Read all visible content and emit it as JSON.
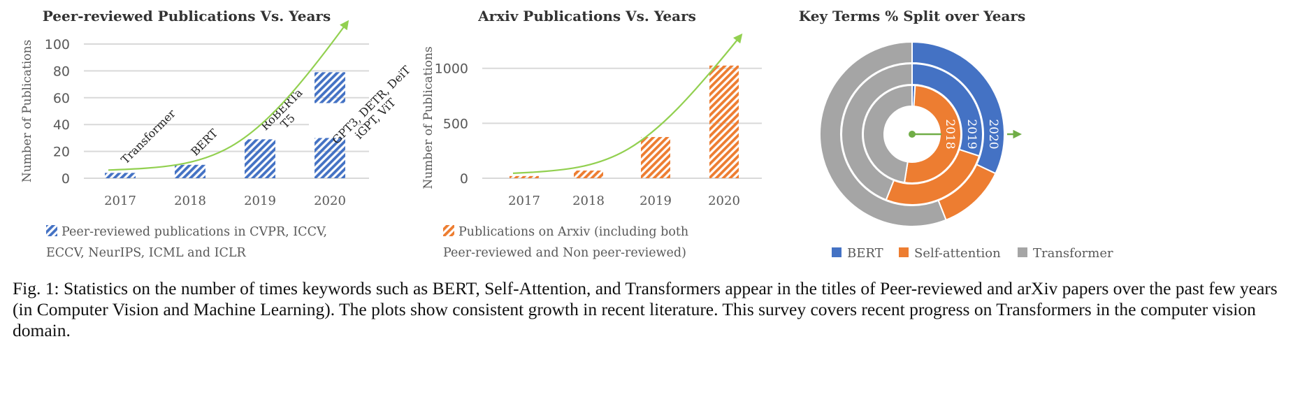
{
  "chart_data": [
    {
      "type": "bar",
      "title": "Peer-reviewed Publications Vs. Years",
      "ylabel": "Number of Publications",
      "xlabel": "",
      "categories": [
        "2017",
        "2018",
        "2019",
        "2020"
      ],
      "values": [
        4,
        10,
        29,
        79
      ],
      "ylim": [
        0,
        100
      ],
      "yticks": [
        0,
        20,
        40,
        60,
        80,
        100
      ],
      "grid": true,
      "bar_color": "#4472c4",
      "bar_fill": "diagonal-hatch",
      "annotations": [
        "Transformer",
        "BERT",
        "RoBERTa\nT5",
        "GPT3, DETR, DeiT\niGPT, ViT"
      ],
      "trend_arrow_color": "#92d050",
      "legend": {
        "position": "bottom",
        "entries": [
          "Peer-reviewed publications in CVPR, ICCV, ECCV, NeurIPS, ICML and ICLR"
        ]
      }
    },
    {
      "type": "bar",
      "title": "Arxiv Publications Vs. Years",
      "ylabel": "Number of Publications",
      "xlabel": "",
      "categories": [
        "2017",
        "2018",
        "2019",
        "2020"
      ],
      "values": [
        20,
        70,
        375,
        1025
      ],
      "ylim": [
        0,
        1100
      ],
      "yticks": [
        0,
        500,
        1000
      ],
      "grid": true,
      "bar_color": "#ed7d31",
      "bar_fill": "diagonal-hatch",
      "trend_arrow_color": "#92d050",
      "legend": {
        "position": "bottom",
        "entries": [
          "Publications on Arxiv (including both Peer-reviewed and Non peer-reviewed)"
        ]
      }
    },
    {
      "type": "pie",
      "subtype": "multi-ring donut",
      "title": "Key Terms % Split over Years",
      "labels": [
        "BERT",
        "Self-attention",
        "Transformer"
      ],
      "colors": [
        "#4472c4",
        "#ed7d31",
        "#a5a5a5"
      ],
      "rings": [
        {
          "name": "2018",
          "values": [
            1,
            51.5,
            47.5
          ]
        },
        {
          "name": "2019",
          "values": [
            30,
            26,
            44
          ]
        },
        {
          "name": "2020",
          "values": [
            32,
            12,
            56
          ]
        }
      ],
      "legend": {
        "position": "bottom"
      }
    }
  ],
  "caption": "Fig. 1: Statistics on the number of times keywords such as BERT, Self-Attention, and Transformers appear in the titles of Peer-reviewed and arXiv papers over the past few years (in Computer Vision and Machine Learning). The plots show consistent growth in recent literature. This survey covers recent progress on Transformers in the computer vision domain."
}
